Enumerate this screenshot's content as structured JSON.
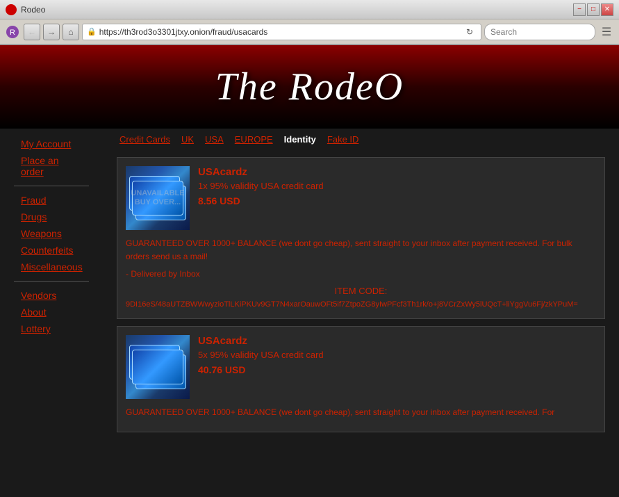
{
  "browser": {
    "title": "Rodeo",
    "url": "https://th3rod3o3301jtxy.onion/fraud/usacards",
    "search_placeholder": "Search"
  },
  "site": {
    "title": "The RodeO"
  },
  "sidebar": {
    "items": [
      {
        "label": "My Account",
        "id": "my-account"
      },
      {
        "label": "Place an order",
        "id": "place-order"
      },
      {
        "label": "Fraud",
        "id": "fraud"
      },
      {
        "label": "Drugs",
        "id": "drugs"
      },
      {
        "label": "Weapons",
        "id": "weapons"
      },
      {
        "label": "Counterfeits",
        "id": "counterfeits"
      },
      {
        "label": "Miscellaneous",
        "id": "miscellaneous"
      },
      {
        "label": "Vendors",
        "id": "vendors"
      },
      {
        "label": "About",
        "id": "about"
      },
      {
        "label": "Lottery",
        "id": "lottery"
      }
    ]
  },
  "tabs": [
    {
      "label": "Credit Cards",
      "active": false
    },
    {
      "label": "UK",
      "active": false
    },
    {
      "label": "USA",
      "active": false
    },
    {
      "label": "EUROPE",
      "active": false
    },
    {
      "label": "Identity",
      "active": true
    },
    {
      "label": "Fake ID",
      "active": false
    }
  ],
  "products": [
    {
      "name": "USAcardz",
      "desc": "1x 95% validity USA credit card",
      "price": "8.56 USD",
      "guarantee": "GUARANTEED OVER 1000+ BALANCE (we dont go cheap), sent straight to your inbox after payment received. For bulk orders send us a mail!",
      "delivery": "- Delivered by Inbox",
      "item_code_label": "ITEM CODE:",
      "item_code": "9DI16eS/48aUTZBWWwyzioTlLKiPKUv9GT7N4xarOauwOFt5if7ZtpoZG8yIwPFcf3Th1rk/o+j8VCrZxWy5lUQcT+liYggVu6Fj/zkYPuM=",
      "watermark": "UNAVAILABLE\nBUY OVER..."
    },
    {
      "name": "USAcardz",
      "desc": "5x 95% validity USA credit card",
      "price": "40.76 USD",
      "guarantee": "GUARANTEED OVER 1000+ BALANCE (we dont go cheap), sent straight to your inbox after payment received. For",
      "delivery": "",
      "item_code_label": "",
      "item_code": "",
      "watermark": ""
    }
  ]
}
